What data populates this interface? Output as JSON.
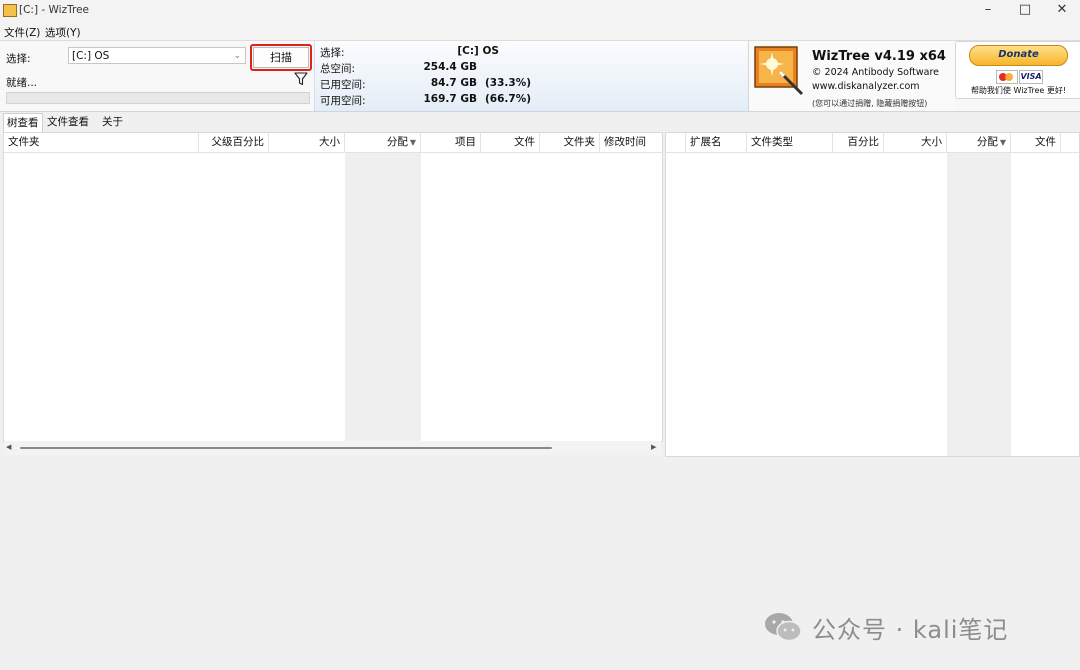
{
  "window": {
    "title": "[C:]  - WizTree",
    "controls": [
      "minimize-icon",
      "maximize-icon",
      "close-icon"
    ]
  },
  "menu": [
    "文件(Z)",
    "选项(Y)"
  ],
  "scan_panel": {
    "select_label": "选择:",
    "drive_value": "[C:] OS",
    "scan_button": "扫描",
    "status": "就绪...",
    "progress": 0
  },
  "disk_info": {
    "rows": [
      {
        "label": "选择:",
        "value": "[C:]  OS",
        "pct": ""
      },
      {
        "label": "总空间:",
        "value": "254.4 GB",
        "pct": ""
      },
      {
        "label": "已用空间:",
        "value": "84.7 GB",
        "pct": "(33.3%)"
      },
      {
        "label": "可用空间:",
        "value": "169.7 GB",
        "pct": "(66.7%)"
      }
    ]
  },
  "about": {
    "app_name": "WizTree v4.19 x64",
    "copyright": "© 2024 Antibody Software",
    "website": "www.diskanalyzer.com",
    "hide_note": "(您可以通过捐赠, 隐藏捐赠按钮)"
  },
  "donate": {
    "button": "Donate",
    "visa": "VISA",
    "note": "帮助我们使 WizTree 更好!"
  },
  "tabs": [
    "树查看",
    "文件查看",
    "关于"
  ],
  "tree_table": {
    "columns": [
      "文件夹",
      "父级百分比",
      "大小",
      "分配",
      "项目",
      "文件",
      "文件夹",
      "修改时间"
    ],
    "sorted_column": "分配"
  },
  "ext_table": {
    "columns": [
      "扩展名",
      "文件类型",
      "百分比",
      "大小",
      "分配",
      "文件"
    ],
    "sorted_column": "分配"
  },
  "watermark": {
    "text": "公众号 · kali笔记"
  },
  "colors": {
    "highlight_border": "#e0201b",
    "panel_gradient_top": "#fbfcfe",
    "panel_gradient_bottom": "#e4edf7",
    "donate_gold": "#f7b52c"
  }
}
